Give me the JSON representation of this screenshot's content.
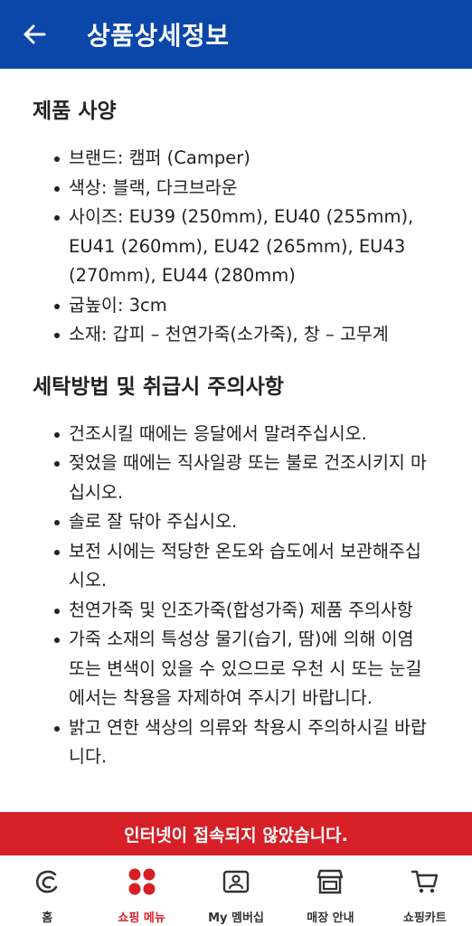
{
  "colors": {
    "header_bg": "#0a47a9",
    "banner_bg": "#d61f26",
    "active": "#d61f26",
    "text": "#222222"
  },
  "header": {
    "back_icon": "arrow-left-icon",
    "title": "상품상세정보"
  },
  "sections": [
    {
      "title": "제품 사양",
      "items": [
        "브랜드: 캠퍼 (Camper)",
        "색상: 블랙, 다크브라운",
        "사이즈: EU39 (250mm), EU40 (255mm), EU41 (260mm), EU42 (265mm), EU43 (270mm), EU44 (280mm)",
        "굽높이: 3cm",
        "소재: 갑피 – 천연가죽(소가죽), 창 – 고무계"
      ]
    },
    {
      "title": "세탁방법 및 취급시 주의사항",
      "items": [
        "건조시킬 때에는 응달에서 말려주십시오.",
        "젖었을 때에는 직사일광 또는 불로 건조시키지 마십시오.",
        "솔로 잘 닦아 주십시오.",
        "보전 시에는 적당한 온도와 습도에서 보관해주십시오.",
        "천연가죽 및 인조가죽(합성가죽) 제품 주의사항",
        "가죽 소재의 특성상 물기(습기, 땀)에 의해 이염 또는 변색이 있을 수 있으므로 우천 시 또는 눈길에서는 착용을 자제하여 주시기 바랍니다.",
        "밝고 연한 색상의 의류와 착용시 주의하시길 바랍니다."
      ]
    }
  ],
  "banner": {
    "text": "인터넷이 접속되지 않았습니다."
  },
  "nav": {
    "items": [
      {
        "label": "홈",
        "icon": "home-c-logo-icon",
        "active": false
      },
      {
        "label": "쇼핑 메뉴",
        "icon": "four-dots-menu-icon",
        "active": true
      },
      {
        "label": "My 멤버십",
        "icon": "membership-card-icon",
        "active": false
      },
      {
        "label": "매장 안내",
        "icon": "store-icon",
        "active": false
      },
      {
        "label": "쇼핑카트",
        "icon": "cart-icon",
        "active": false
      }
    ]
  }
}
